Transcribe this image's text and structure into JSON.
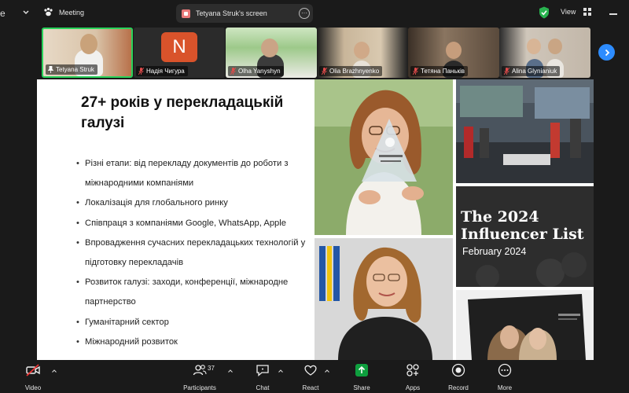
{
  "topbar": {
    "edge_text": "e",
    "meeting_label": "Meeting",
    "share_label": "Tetyana Struk's screen",
    "view_label": "View"
  },
  "participants": [
    {
      "name": "Tetyana Struk"
    },
    {
      "name": "Надія Чигура",
      "logo": "N"
    },
    {
      "name": "Olha Yanyshyn"
    },
    {
      "name": "Olia Brazhnyenko"
    },
    {
      "name": "Тетяна Паньків"
    },
    {
      "name": "Alina Glynianiuk"
    }
  ],
  "slide": {
    "title": "27+ років у перекладацькій галузі",
    "bullets": [
      "Різні етапи: від перекладу документів до роботи з міжнародними компаніями",
      "Локалізація для глобального ринку",
      "Співпраця з компаніями Google, WhatsApp, Apple",
      "Впровадження сучасних перекладацьких технологій у підготовку перекладачів",
      "Розвиток галузі: заходи, конференції, міжнародне партнерство",
      "Гуманітарний сектор",
      "Міжнародний розвиток"
    ],
    "influencer_title": "The 2024 Influencer List",
    "influencer_date": "February 2024"
  },
  "toolbar": {
    "video": "Video",
    "participants": "Participants",
    "participants_count": "37",
    "chat": "Chat",
    "react": "React",
    "share": "Share",
    "apps": "Apps",
    "record": "Record",
    "more": "More"
  },
  "colors": {
    "active_border": "#29d35b",
    "share_green": "#0e9f3e",
    "record_red": "#e02f2f",
    "next_arrow": "#2d8cff"
  }
}
